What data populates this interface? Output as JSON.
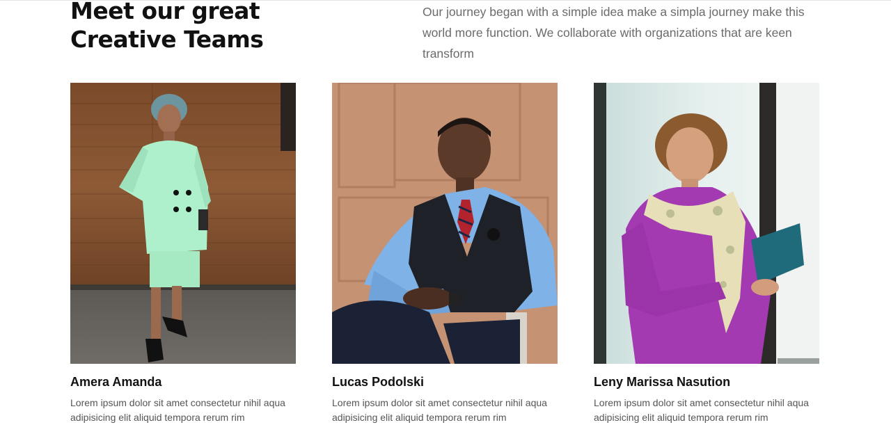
{
  "section": {
    "heading_line1": "Meet our great",
    "heading_line2": "Creative Teams",
    "intro": "Our journey began with a simple idea make a simpla journey make this world more function. We collaborate with organizations that are keen transform"
  },
  "team": [
    {
      "name": "Amera Amanda",
      "desc_line1": "Lorem ipsum dolor sit amet consectetur nihil aqua",
      "desc_line2": "adipisicing elit aliquid tempora rerum rim"
    },
    {
      "name": "Lucas Podolski",
      "desc_line1": "Lorem ipsum dolor sit amet consectetur nihil aqua",
      "desc_line2": "adipisicing elit aliquid tempora rerum rim"
    },
    {
      "name": "Leny Marissa Nasution",
      "desc_line1": "Lorem ipsum dolor sit amet consectetur nihil aqua",
      "desc_line2": "adipisicing elit aliquid tempora rerum rim"
    }
  ]
}
